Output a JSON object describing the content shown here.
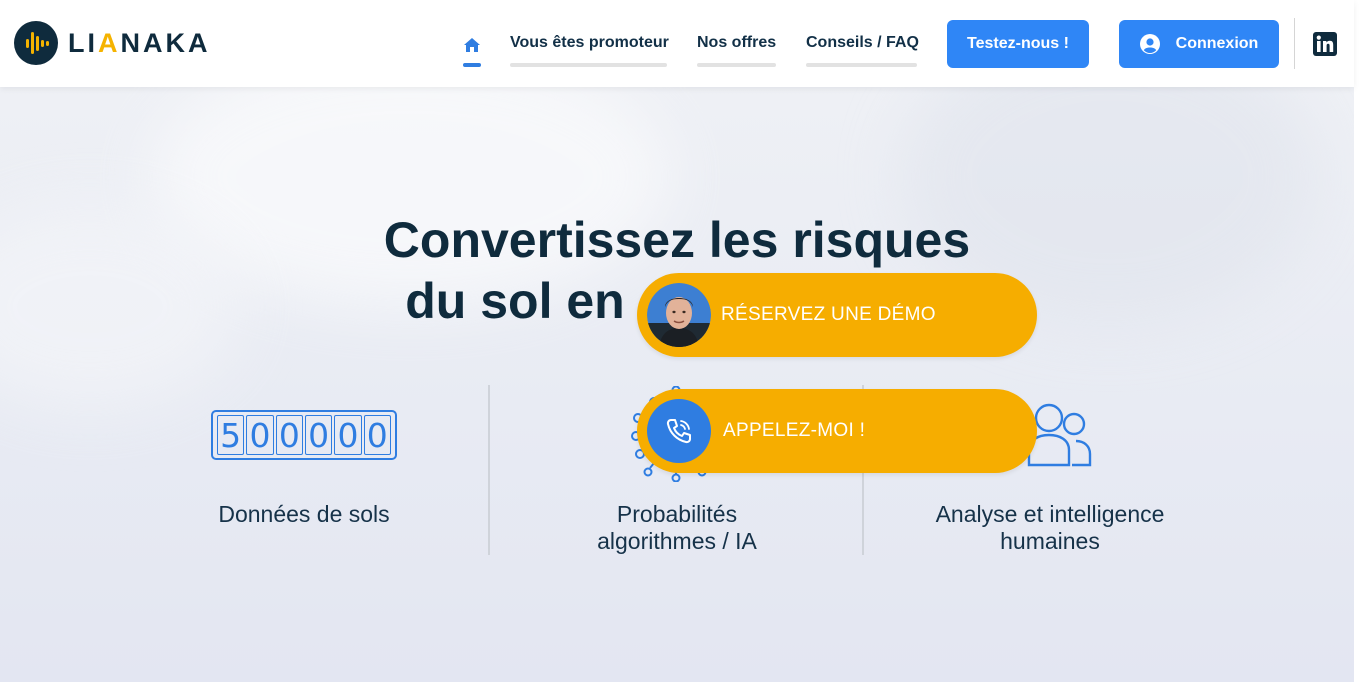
{
  "header": {
    "logo": {
      "part1": "LI",
      "part2": "A",
      "part3": "NAKA"
    },
    "nav": [
      {
        "label": "Vous êtes promoteur"
      },
      {
        "label": "Nos offres"
      },
      {
        "label": "Conseils / FAQ"
      }
    ],
    "test_button": "Testez-nous !",
    "login_button": "Connexion"
  },
  "hero": {
    "headline_line1": "Convertissez les risques",
    "headline_line2_visible": "du sol en",
    "features": [
      {
        "label": "Données de sols",
        "digits": [
          "5",
          "0",
          "0",
          "0",
          "0",
          "0"
        ]
      },
      {
        "label_line1": "Probabilités",
        "label_line2": "algorithmes / IA"
      },
      {
        "label_line1": "Analyse et intelligence",
        "label_line2": "humaines"
      }
    ]
  },
  "cta": {
    "demo_label": "RÉSERVEZ UNE DÉMO",
    "call_label": "APPELEZ-MOI !"
  },
  "colors": {
    "brand_dark": "#0f2b3d",
    "brand_yellow": "#f5b300",
    "cta_orange": "#f6ad00",
    "primary_blue": "#2f86f6",
    "icon_blue": "#2f7de1"
  },
  "icons": [
    "home-icon",
    "user-circle-icon",
    "linkedin-icon",
    "phone-icon",
    "network-icon",
    "users-icon"
  ]
}
